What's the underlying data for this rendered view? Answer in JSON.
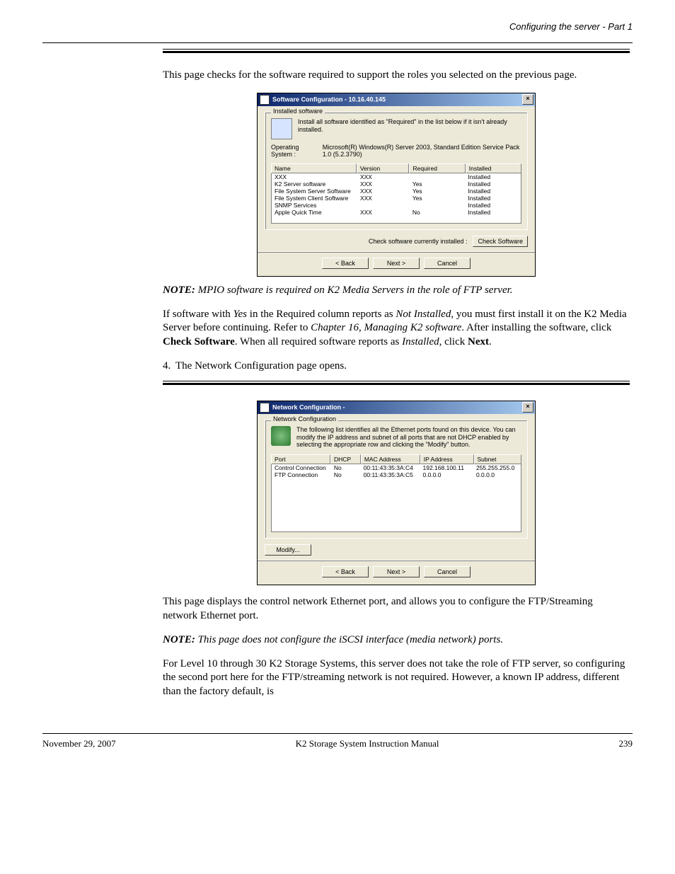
{
  "header": {
    "breadcrumb": "Configuring the server - Part 1",
    "footer_date": "November 29, 2007",
    "footer_title": "K2 Storage System Instruction Manual",
    "footer_page": "239"
  },
  "para1": "This page checks for the software required to support the roles you selected on the previous page.",
  "dialog1": {
    "title": "Software Configuration - 10.16.40.145",
    "group_label": "Installed software",
    "msg": "Install all software identified as \"Required\" in the list below if it isn't already installed.",
    "os_label": "Operating System :",
    "os_value": "Microsoft(R) Windows(R) Server 2003, Standard Edition Service Pack 1.0 (5.2.3790)",
    "cols": {
      "name": "Name",
      "version": "Version",
      "required": "Required",
      "installed": "Installed"
    },
    "rows": [
      {
        "name": "XXX",
        "version": "XXX",
        "required": "",
        "installed": "Installed"
      },
      {
        "name": "K2 Server software",
        "version": "XXX",
        "required": "Yes",
        "installed": "Installed"
      },
      {
        "name": "File System Server Software",
        "version": "XXX",
        "required": "Yes",
        "installed": "Installed"
      },
      {
        "name": "File System Client Software",
        "version": "XXX",
        "required": "Yes",
        "installed": "Installed"
      },
      {
        "name": "SNMP Services",
        "version": "",
        "required": "",
        "installed": "Installed"
      },
      {
        "name": "Apple Quick Time",
        "version": "XXX",
        "required": "No",
        "installed": "Installed"
      }
    ],
    "check_label": "Check software currently installed :",
    "check_btn": "Check Software",
    "back": "< Back",
    "next": "Next >",
    "cancel": "Cancel"
  },
  "note1_label": "NOTE:",
  "note1": "MPIO software is required on K2 Media Servers in the role of FTP server.",
  "para2": "If software with Yes in the Required column reports as Not Installed, you must first install it on the K2 Media Server before continuing. Refer to Chapter 16, Managing K2 software. After installing the software, click Check Software. When all required software reports as Installed, click Next.",
  "step4": "4. ",
  "step4_text": "The Network Configuration page opens.",
  "dialog2": {
    "title": "Network Configuration -",
    "group_label": "Network Configuration",
    "msg": "The following list identifies all the Ethernet ports found on this device. You can modify the IP address and subnet of all ports that are not DHCP enabled by selecting the appropriate row and clicking the \"Modify\" button.",
    "cols": {
      "port": "Port",
      "dhcp": "DHCP",
      "mac": "MAC Address",
      "ip": "IP Address",
      "subnet": "Subnet"
    },
    "rows": [
      {
        "port": "Control Connection",
        "dhcp": "No",
        "mac": "00:11:43:35:3A:C4",
        "ip": "192.168.100.11",
        "subnet": "255.255.255.0"
      },
      {
        "port": "FTP Connection",
        "dhcp": "No",
        "mac": "00:11:43:35:3A:C5",
        "ip": "0.0.0.0",
        "subnet": "0.0.0.0"
      }
    ],
    "modify": "Modify...",
    "back": "< Back",
    "next": "Next >",
    "cancel": "Cancel"
  },
  "para3": "This page displays the control network Ethernet port, and allows you to configure the FTP/Streaming network Ethernet port.",
  "note2_label": "NOTE:",
  "note2": "This page does not configure the iSCSI interface (media network) ports.",
  "para4": "For Level 10 through 30 K2 Storage Systems, this server does not take the role of FTP server, so configuring the second port here for the FTP/streaming network is not required. However, a known IP address, different than the factory default, is"
}
